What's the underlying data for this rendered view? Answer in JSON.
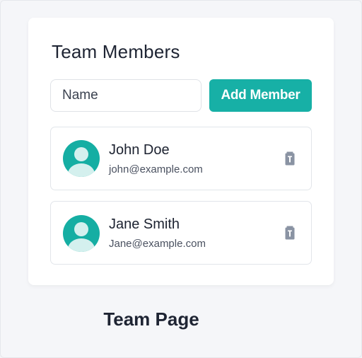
{
  "header": {
    "title": "Team Members"
  },
  "form": {
    "name_placeholder": "Name",
    "add_button_label": "Add Member"
  },
  "members": [
    {
      "name": "John Doe",
      "email": "john@example.com",
      "avatar_icon": "user-avatar-icon",
      "delete_icon": "trash-icon"
    },
    {
      "name": "Jane Smith",
      "email": "Jane@example.com",
      "avatar_icon": "user-avatar-icon",
      "delete_icon": "trash-icon"
    }
  ],
  "footer": {
    "caption": "Team Page"
  },
  "colors": {
    "accent": "#17b0a6",
    "background": "#f3f4f7",
    "card": "#ffffff",
    "text": "#1e2433",
    "icon": "#8a93a3"
  }
}
